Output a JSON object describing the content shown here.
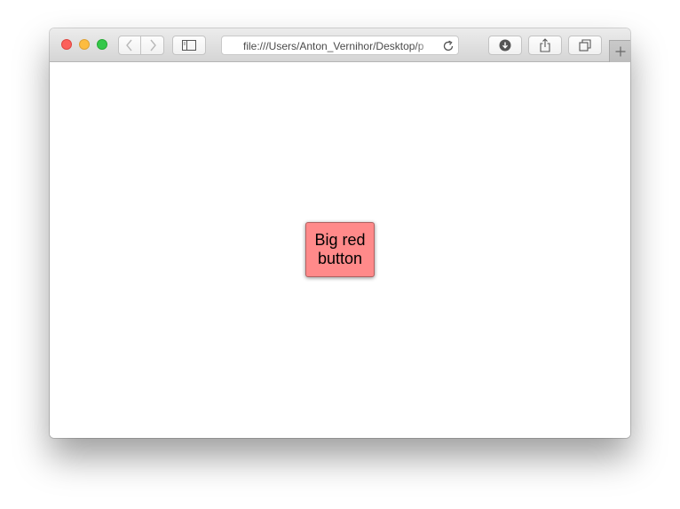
{
  "browser": {
    "address_bar": {
      "url": "file:///Users/Anton_Vernihor/Desktop/p"
    },
    "icons": {
      "back": "chevron-left-icon",
      "forward": "chevron-right-icon",
      "sidebar": "sidebar-icon",
      "reload": "reload-icon",
      "download": "download-icon",
      "share": "share-icon",
      "tabs": "tabs-icon",
      "new_tab": "plus-icon"
    },
    "colors": {
      "close": "#fc605b",
      "minimize": "#fdbc40",
      "zoom": "#34c84a"
    }
  },
  "page": {
    "button": {
      "label": "Big red button",
      "color": "#ff8a8a"
    }
  }
}
